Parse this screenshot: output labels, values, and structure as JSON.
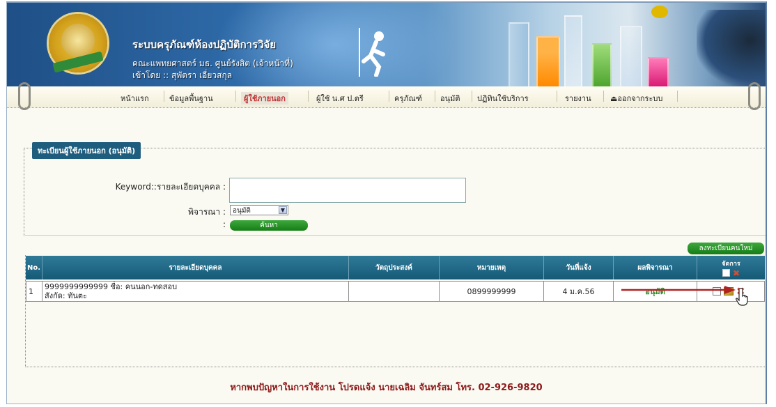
{
  "header": {
    "app_title": "ระบบครุภัณฑ์ห้องปฏิบัติการวิจัย",
    "org_line": "คณะแพทยศาสตร์ มธ. ศูนย์รังสิต (เจ้าหน้าที่)",
    "user_line": "เข้าโดย :: สุพัตรา เอี่ยวสกุล"
  },
  "nav": {
    "items": [
      "หน้าแรก",
      "ข้อมูลพื้นฐาน",
      "ผู้ใช้ภายนอก",
      "ผู้ใช้ น.ศ ป.ตรี",
      "ครุภัณฑ์",
      "อนุมัติ",
      "ปฏิทินใช้บริการ",
      "รายงาน",
      "ออกจากระบบ"
    ],
    "active_index": 2
  },
  "section": {
    "legend": "ทะเบียนผู้ใช้ภายนอก (อนุมัติ)",
    "keyword_label": "Keyword::รายละเอียดบุคคล :",
    "keyword_value": "",
    "consider_label": "พิจารณา :",
    "consider_value": "อนุมัติ",
    "search_colon": ":",
    "search_button": "ค้นหา",
    "new_button": "ลงทะเบียนคนใหม่"
  },
  "table": {
    "headers": [
      "No.",
      "รายละเอียดบุคคล",
      "วัตถุประสงค์",
      "หมายเหตุ",
      "วันที่แจ้ง",
      "ผลพิจารณา",
      "จัดการ"
    ],
    "rows": [
      {
        "no": "1",
        "person_line1": "9999999999999 ชื่อ: คนนอก-ทดสอบ",
        "person_line2": "สังกัด: ทันตะ",
        "purpose": "",
        "note": "0899999999",
        "date": "4 ม.ค.56",
        "result": "อนุมัติ"
      }
    ]
  },
  "footer": {
    "text": "หากพบปัญหาในการใช้งาน โปรดแจ้ง นายเฉลิม จันทร์สม โทร. 02-926-9820"
  },
  "colors": {
    "banner_blue": "#2e6aa8",
    "table_header": "#1e6a88",
    "nav_active": "#c03838",
    "button_green": "#1f8a1f",
    "result_green": "#2f8a2f",
    "footer_red": "#8b1a1a",
    "delete_red": "#d23a2a",
    "annotation_arrow": "#b22222"
  },
  "icons": [
    "logo-seal",
    "running-figure",
    "logout-icon",
    "checkbox",
    "edit-icon",
    "delete-icon",
    "hand-cursor"
  ]
}
